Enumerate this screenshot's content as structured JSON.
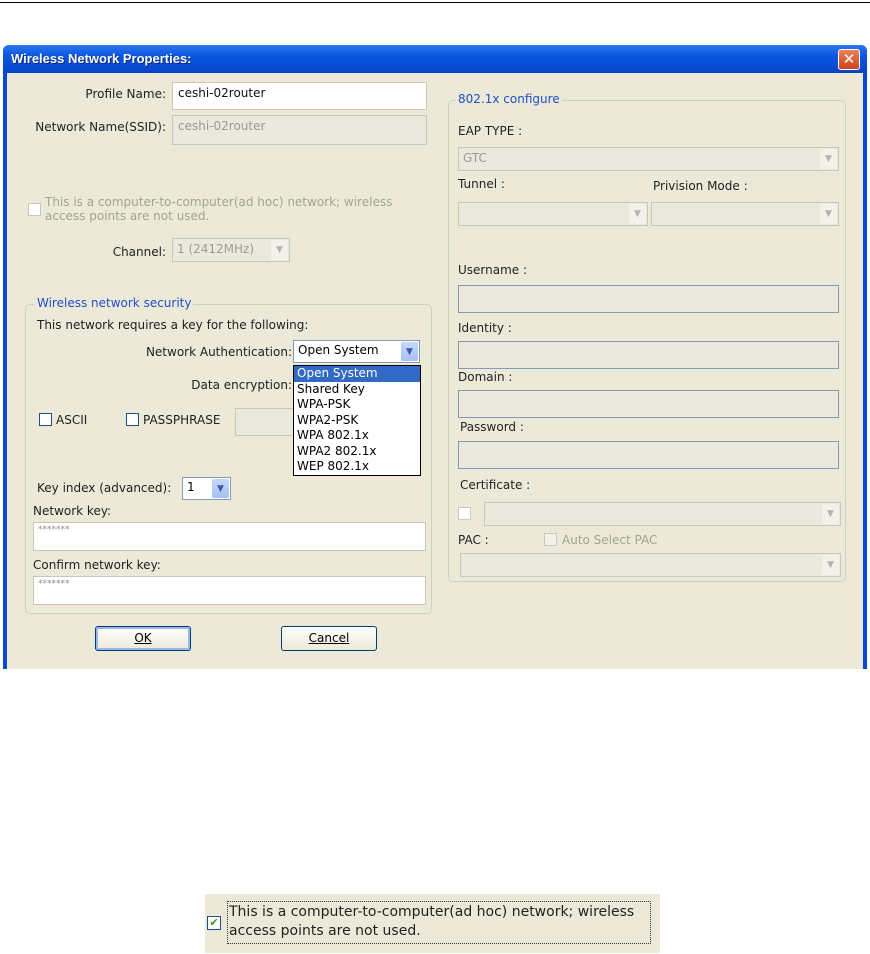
{
  "dialog": {
    "title": "Wireless Network Properties:",
    "close_icon": "close-icon",
    "profile_name_label": "Profile Name:",
    "profile_name_value": "ceshi-02router",
    "ssid_label": "Network Name(SSID):",
    "ssid_value": "ceshi-02router",
    "adhoc_line1": "This is a computer-to-computer(ad hoc) network; wireless",
    "adhoc_line2": "access points are not used.",
    "channel_label": "Channel:",
    "channel_value": "1  (2412MHz)",
    "security": {
      "legend": "Wireless network security",
      "requires_text": "This network requires a key for the following:",
      "auth_label": "Network Authentication:",
      "auth_value": "Open System",
      "auth_options": [
        "Open System",
        "Shared Key",
        "WPA-PSK",
        "WPA2-PSK",
        "WPA 802.1x",
        "WPA2 802.1x",
        "WEP 802.1x"
      ],
      "encryption_label": "Data encryption:",
      "ascii_label": "ASCII",
      "passphrase_label": "PASSPHRASE",
      "key_index_label": "Key index (advanced):",
      "key_index_value": "1",
      "network_key_label": "Network key:",
      "network_key_value": "*******",
      "confirm_key_label": "Confirm network key:",
      "confirm_key_value": "*******"
    },
    "ok_label": "OK",
    "cancel_label": "Cancel",
    "dot1x": {
      "legend": "802.1x configure",
      "eap_label": "EAP TYPE :",
      "eap_value": "GTC",
      "tunnel_label": "Tunnel :",
      "provision_label": "Privision Mode :",
      "username_label": "Username :",
      "identity_label": "Identity :",
      "domain_label": "Domain :",
      "password_label": "Password :",
      "certificate_label": "Certificate :",
      "pac_label": "PAC :",
      "auto_pac_label": "Auto Select PAC"
    }
  },
  "snippet": {
    "line1": "This is a computer-to-computer(ad hoc) network; wireless",
    "line2": "access points are not used.",
    "checked": true
  }
}
